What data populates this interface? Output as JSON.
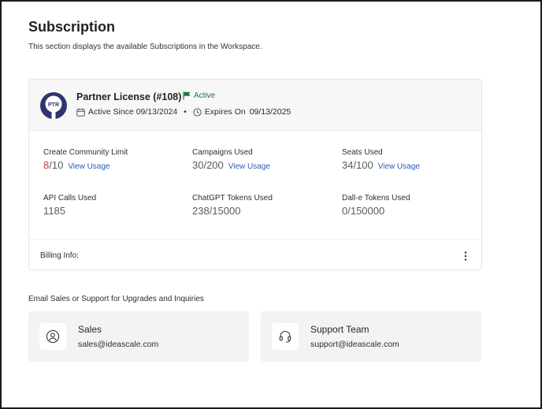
{
  "page": {
    "title": "Subscription",
    "description": "This section displays the available Subscriptions in the Workspace."
  },
  "subscription": {
    "logo_text": "PTR",
    "license_title": "Partner License (#108)",
    "status": "Active",
    "active_since_label": "Active Since 09/13/2024",
    "dot": "•",
    "expires_label": "Expires On",
    "expires_date": "09/13/2025",
    "stats": [
      {
        "label": "Create Community Limit",
        "used": "8",
        "limit": "/10",
        "link": "View Usage"
      },
      {
        "label": "Campaigns Used",
        "used": "30",
        "limit": "/200",
        "link": "View Usage"
      },
      {
        "label": "Seats Used",
        "used": "34",
        "limit": "/100",
        "link": "View Usage"
      },
      {
        "label": "API Calls Used",
        "value": "1185"
      },
      {
        "label": "ChatGPT Tokens Used",
        "value": "238/15000"
      },
      {
        "label": "Dall-e Tokens Used",
        "value": "0/150000"
      }
    ],
    "billing_label": "Billing Info:"
  },
  "contacts": {
    "heading": "Email Sales or Support for Upgrades and Inquiries",
    "sales": {
      "name": "Sales",
      "email": "sales@ideascale.com",
      "icon": "user-circle-icon"
    },
    "support": {
      "name": "Support Team",
      "email": "support@ideascale.com",
      "icon": "headset-icon"
    }
  },
  "colors": {
    "accent_link": "#2b5cb8",
    "status_green": "#1b7a3a",
    "logo_navy": "#2d3470",
    "limit_red": "#d0382e"
  }
}
